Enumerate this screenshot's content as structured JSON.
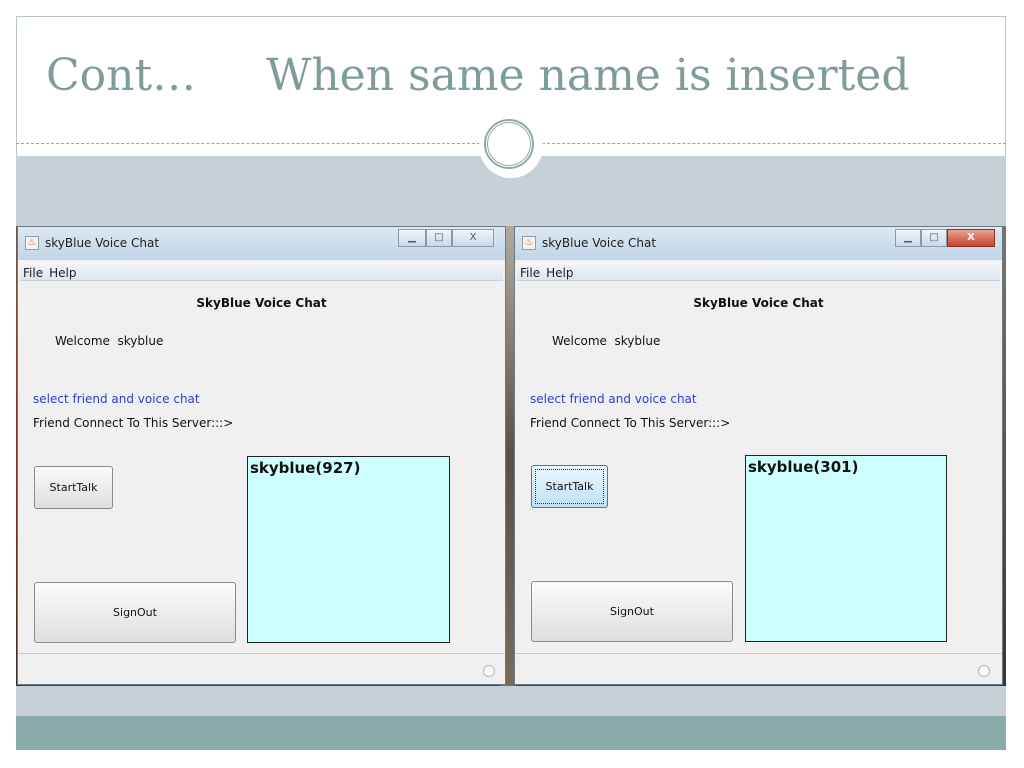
{
  "slide": {
    "title": "Cont…     When same name is inserted",
    "colors": {
      "title": "#7f9c9c",
      "band": "#c5d1d7",
      "teal_band": "#8aabab"
    }
  },
  "windows": [
    {
      "title": "skyBlue Voice Chat",
      "controls": {
        "minimize": "▁",
        "maximize": "□",
        "close": "X"
      },
      "menu": [
        "File",
        "Help"
      ],
      "heading": "SkyBlue Voice Chat",
      "welcome": "Welcome  skyblue",
      "select_text": "select friend and voice chat",
      "connect_text": "Friend Connect To This Server:::>",
      "start_button": "StartTalk",
      "signout_button": "SignOut",
      "friends": [
        "skyblue(927)"
      ]
    },
    {
      "title": "skyBlue Voice Chat",
      "controls": {
        "minimize": "▁",
        "maximize": "□",
        "close": "X"
      },
      "menu": [
        "File",
        "Help"
      ],
      "heading": "SkyBlue Voice Chat",
      "welcome": "Welcome  skyblue",
      "select_text": "select friend and voice chat",
      "connect_text": "Friend Connect To This Server:::>",
      "start_button": "StartTalk",
      "signout_button": "SignOut",
      "friends": [
        "skyblue(301)"
      ]
    }
  ]
}
